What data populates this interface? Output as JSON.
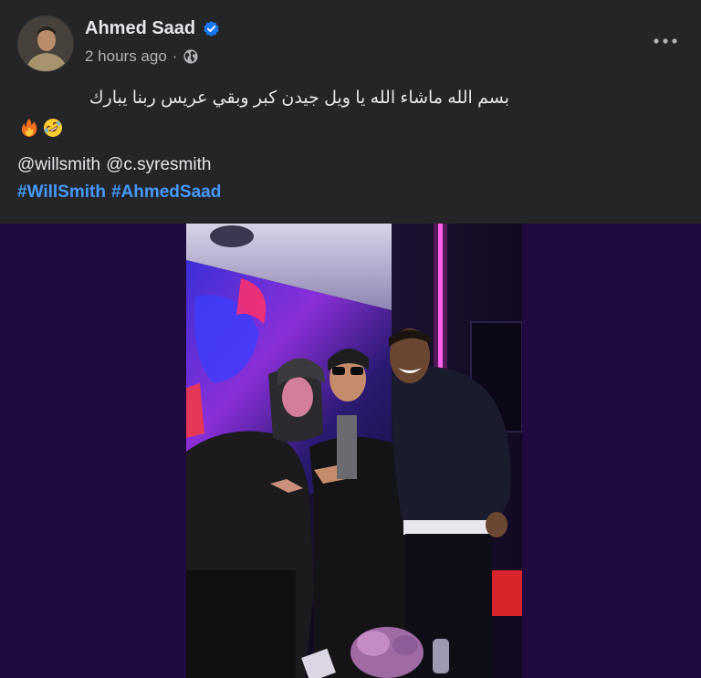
{
  "post": {
    "author": "Ahmed Saad",
    "timestamp": "2 hours ago",
    "separator": "·",
    "audience_icon": "globe-icon",
    "verified_icon": "verified-badge-icon",
    "more_icon": "more-options-icon",
    "text_arabic": "بسم الله ماشاء الله يا ويل جيدن كبر وبقي عريس ربنا يبارك",
    "emojis": [
      "fire-icon",
      "rolling-laughing-icon"
    ],
    "mentions": [
      "@willsmith",
      "@c.syresmith"
    ],
    "hashtags": [
      "#WillSmith",
      "#AhmedSaad"
    ],
    "photo_alt_icon": "group-photo"
  },
  "colors": {
    "background": "#242526",
    "text": "#e4e6eb",
    "secondary_text": "#b0b3b8",
    "hashtag": "#4599ff",
    "verified": "#1877f2",
    "photo_letterbox": "#200a3f"
  }
}
